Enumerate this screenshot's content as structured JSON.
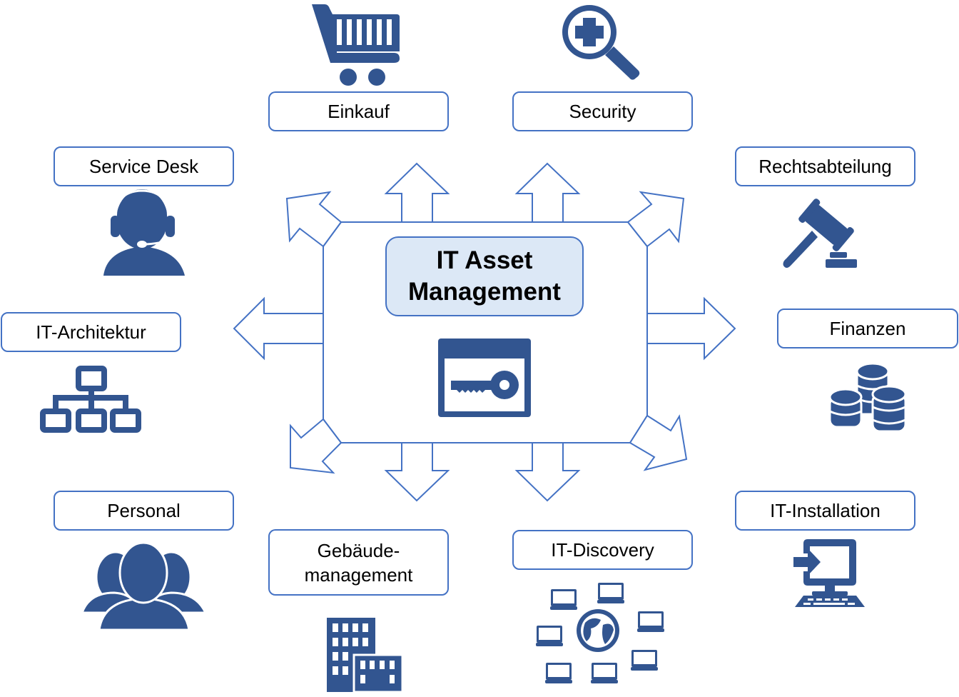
{
  "title": {
    "line1": "IT Asset",
    "line2": "Management",
    "icon": "key-window-icon"
  },
  "colors": {
    "icon": "#325590",
    "border": "#4472c4",
    "title_fill": "#dce8f6"
  },
  "nodes": [
    {
      "id": "einkauf",
      "label": "Einkauf",
      "icon": "shopping-cart-icon"
    },
    {
      "id": "security",
      "label": "Security",
      "icon": "magnifier-plus-icon"
    },
    {
      "id": "service-desk",
      "label": "Service Desk",
      "icon": "headset-agent-icon"
    },
    {
      "id": "rechtsabteilung",
      "label": "Rechtsabteilung",
      "icon": "gavel-icon"
    },
    {
      "id": "it-architektur",
      "label": "IT-Architektur",
      "icon": "hierarchy-icon"
    },
    {
      "id": "finanzen",
      "label": "Finanzen",
      "icon": "coin-stacks-icon"
    },
    {
      "id": "personal",
      "label": "Personal",
      "icon": "people-group-icon"
    },
    {
      "id": "gebaeudemanagement",
      "label_line1": "Gebäude-",
      "label_line2": "management",
      "icon": "office-building-icon"
    },
    {
      "id": "it-discovery",
      "label": "IT-Discovery",
      "icon": "globe-network-icon"
    },
    {
      "id": "it-installation",
      "label": "IT-Installation",
      "icon": "computer-install-icon"
    }
  ]
}
